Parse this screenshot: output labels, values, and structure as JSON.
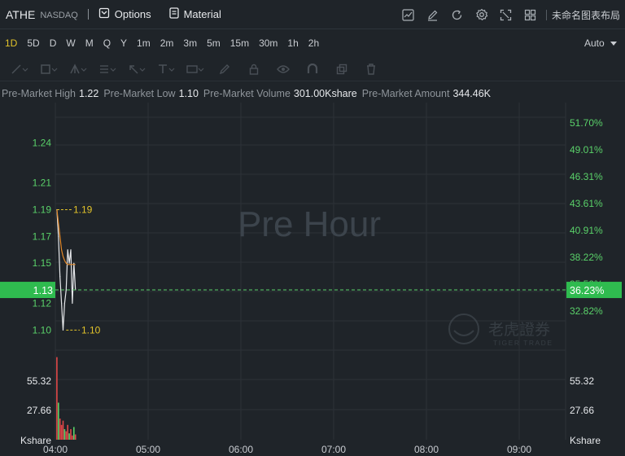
{
  "header": {
    "ticker": "ATHE",
    "exchange": "NASDAQ",
    "options_label": "Options",
    "material_label": "Material",
    "layout_label": "未命名图表布局"
  },
  "periods": [
    "1D",
    "5D",
    "D",
    "W",
    "M",
    "Q",
    "Y",
    "1m",
    "2m",
    "3m",
    "5m",
    "15m",
    "30m",
    "1h",
    "2h"
  ],
  "active_period": "1D",
  "scale_mode": "Auto",
  "stats": [
    {
      "label": "Pre-Market High",
      "value": "1.22"
    },
    {
      "label": "Pre-Market Low",
      "value": "1.10"
    },
    {
      "label": "Pre-Market Volume",
      "value": "301.00Kshare"
    },
    {
      "label": "Pre-Market Amount",
      "value": "344.46K"
    }
  ],
  "watermark": "Pre Hour",
  "logo": {
    "cn": "老虎證券",
    "en": "TIGER TRADE"
  },
  "colors": {
    "up": "#5ad169",
    "down": "#e04848",
    "avg": "#e58a2a",
    "price": "#e6e8eb",
    "accent": "#e2c32a"
  },
  "chart_data": {
    "type": "line",
    "price_axis": {
      "ticks": [
        "1.24",
        "1.21",
        "1.19",
        "1.17",
        "1.15",
        "1.12",
        "1.10"
      ],
      "tick_values": [
        1.24,
        1.21,
        1.19,
        1.17,
        1.15,
        1.12,
        1.1
      ],
      "range": [
        1.085,
        1.27
      ]
    },
    "pct_axis": {
      "ticks": [
        "51.70%",
        "49.01%",
        "46.31%",
        "43.61%",
        "40.91%",
        "38.22%",
        "35.52%",
        "32.82%"
      ],
      "tick_prices": [
        1.2547,
        1.2347,
        1.2146,
        1.1946,
        1.1745,
        1.1545,
        1.1344,
        1.1143
      ]
    },
    "x_labels": [
      "04:00",
      "05:00",
      "06:00",
      "07:00",
      "08:00",
      "09:00"
    ],
    "x_range": [
      0,
      330
    ],
    "current_price": {
      "value": 1.13,
      "label": "1.13",
      "pct_label": "36.23%"
    },
    "high_marker": {
      "value": 1.19,
      "label": "1.19",
      "x": 1
    },
    "low_marker": {
      "value": 1.1,
      "label": "1.10",
      "x": 7
    },
    "price_series": {
      "name": "price",
      "x": [
        1,
        2,
        3,
        4,
        5,
        6,
        7,
        8,
        9,
        10,
        11,
        12,
        13
      ],
      "values": [
        1.19,
        1.17,
        1.14,
        1.12,
        1.1,
        1.12,
        1.13,
        1.16,
        1.15,
        1.16,
        1.12,
        1.15,
        1.13
      ]
    },
    "avg_series": {
      "name": "avg",
      "x": [
        1,
        2,
        3,
        4,
        5,
        6,
        7,
        8,
        9,
        10,
        11,
        12,
        13
      ],
      "values": [
        1.19,
        1.18,
        1.17,
        1.16,
        1.155,
        1.152,
        1.15,
        1.149,
        1.149,
        1.149,
        1.149,
        1.149,
        1.149
      ]
    },
    "volume": {
      "ticks": [
        "55.32",
        "27.66"
      ],
      "tick_values": [
        55.32,
        27.66
      ],
      "unit": "Kshare",
      "max": 80,
      "x": [
        1,
        2,
        3,
        4,
        5,
        6,
        7,
        8,
        9,
        10,
        11,
        12,
        13
      ],
      "values": [
        78,
        35,
        20,
        14,
        18,
        10,
        8,
        14,
        6,
        10,
        4,
        12,
        5
      ],
      "up": [
        false,
        true,
        false,
        false,
        false,
        true,
        false,
        false,
        true,
        false,
        false,
        true,
        false
      ]
    }
  }
}
